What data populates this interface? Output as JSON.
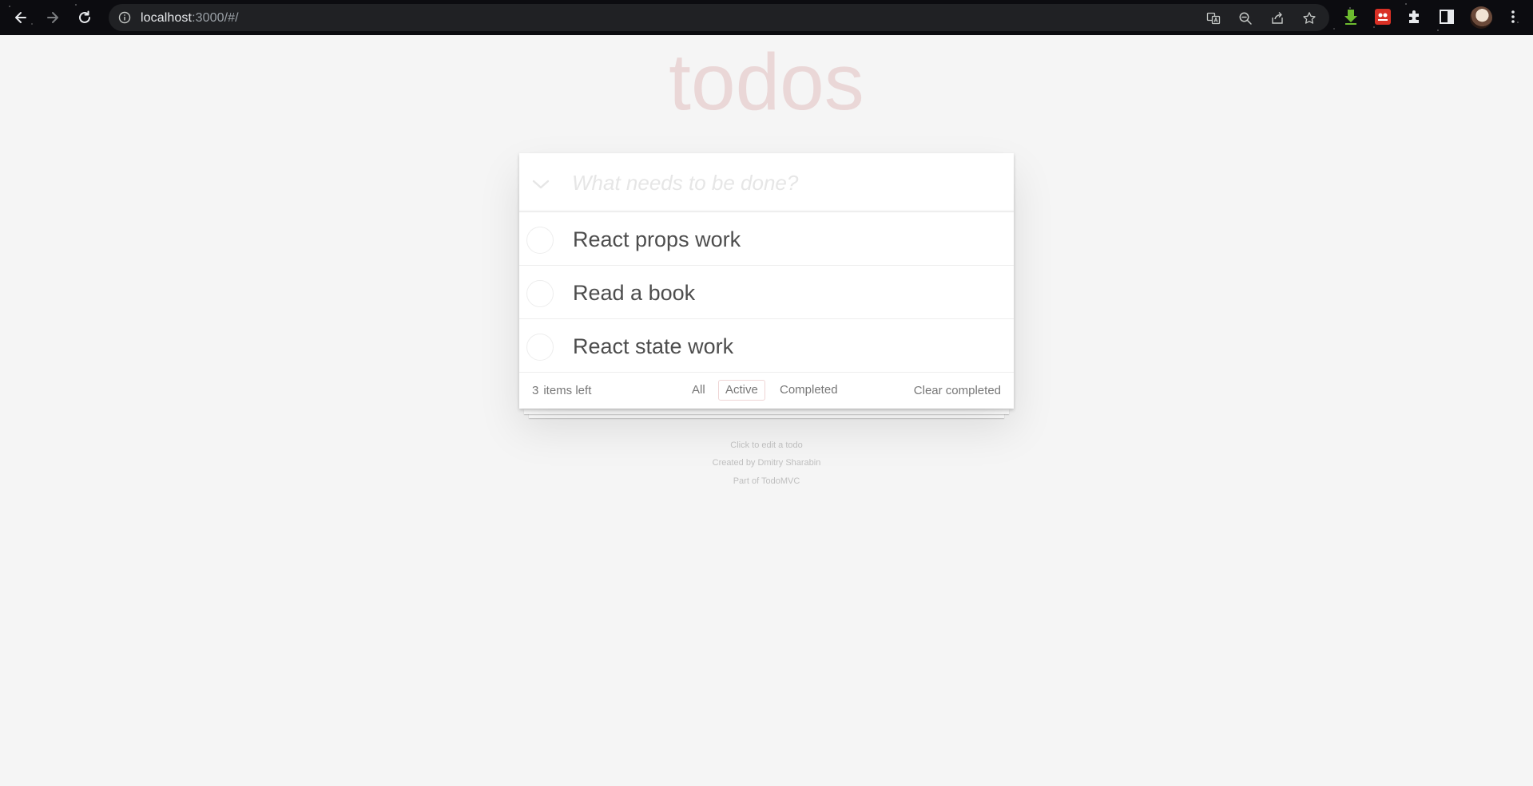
{
  "browser": {
    "url_host": "localhost",
    "url_path": ":3000/#/",
    "icons": [
      "back-icon",
      "forward-icon",
      "reload-icon",
      "site-info-icon",
      "translate-icon",
      "zoom-out-icon",
      "share-icon",
      "bookmark-star-icon",
      "download-icon",
      "extension-red-icon",
      "puzzle-extensions-icon",
      "side-panel-icon",
      "profile-avatar",
      "menu-kebab-icon"
    ]
  },
  "app": {
    "title": "todos",
    "new_todo_placeholder": "What needs to be done?",
    "items": [
      {
        "label": "React props work",
        "completed": false
      },
      {
        "label": "Read a book",
        "completed": false
      },
      {
        "label": "React state work",
        "completed": false
      }
    ],
    "footer": {
      "count": "3",
      "count_suffix": "items left",
      "filters": [
        "All",
        "Active",
        "Completed"
      ],
      "selected_filter": "Active",
      "clear_label": "Clear completed"
    }
  },
  "info": {
    "line1": "Click to edit a todo",
    "line2": "Created by Dmitry Sharabin",
    "line3": "Part of TodoMVC"
  },
  "colors": {
    "title": "#af2f2f",
    "background": "#f5f5f5",
    "chrome": "#0c0c10",
    "omnibox": "#202124"
  }
}
